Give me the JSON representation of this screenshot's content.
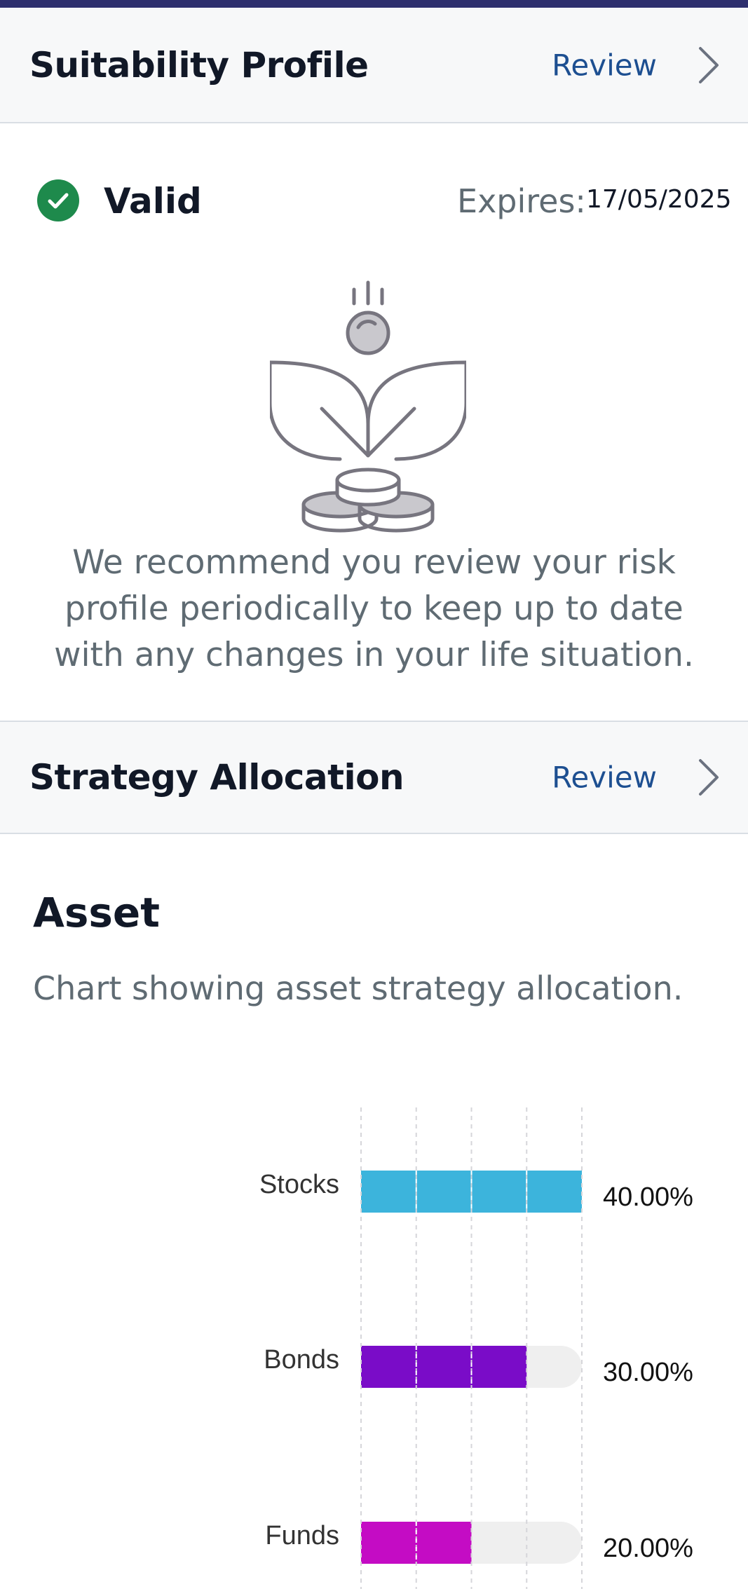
{
  "suitability": {
    "title": "Suitability Profile",
    "review_label": "Review",
    "status": "Valid",
    "expires_label": "Expires:",
    "expires_date": "17/05/2025",
    "recommendation": "We recommend you review your risk profile periodically to keep up to date with any changes in your life situation."
  },
  "strategy": {
    "title": "Strategy Allocation",
    "review_label": "Review"
  },
  "asset": {
    "title": "Asset",
    "description": "Chart showing asset strategy allocation."
  },
  "colors": {
    "brand_bar": "#2e2f6e",
    "valid_green": "#1e8a4c",
    "link_blue": "#1d4f91"
  },
  "chart_data": {
    "type": "bar",
    "orientation": "horizontal",
    "categories": [
      "Stocks",
      "Bonds",
      "Funds"
    ],
    "values": [
      40,
      30,
      20
    ],
    "value_labels": [
      "40.00%",
      "30.00%",
      "20.00%"
    ],
    "colors": [
      "#3cb4dc",
      "#7a0cc8",
      "#c40cc4"
    ],
    "xlim": [
      0,
      40
    ],
    "grid": true
  }
}
